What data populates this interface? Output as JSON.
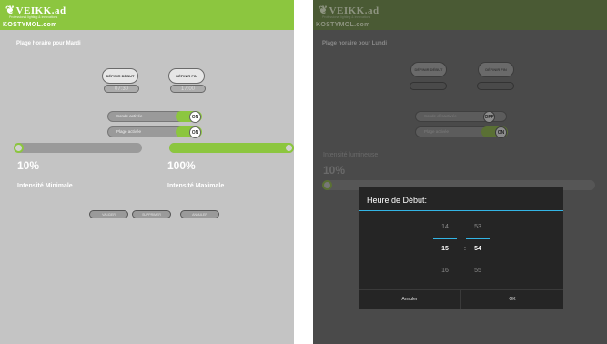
{
  "brand": {
    "logo_text": "VEIKK.ad",
    "tagline": "Professional lighting & innovations",
    "secondary": "KOSTYMOL.com"
  },
  "left": {
    "title": "Plage horaire pour Mardi",
    "set_start_label": "DÉFINIR DÉBUT",
    "set_end_label": "DÉFINIR FIN",
    "start_value": "07:30",
    "end_value": "17:00",
    "sensor_label": "Sonde activée",
    "sensor_state": "ON",
    "schedule_label": "Plage activée",
    "schedule_state": "ON",
    "min_pct": "10%",
    "max_pct": "100%",
    "min_label": "Intensité Minimale",
    "max_label": "Intensité Maximale",
    "min_fraction": 0.0,
    "max_fraction": 1.0,
    "buttons": {
      "validate": "VALIDER",
      "delete": "SUPPRIMER",
      "cancel": "ANNULER"
    }
  },
  "right": {
    "title": "Plage horaire pour Lundi",
    "set_start_label": "DÉFINIR DÉBUT",
    "set_end_label": "DÉFINIR FIN",
    "sensor_label": "Sonde désactivée",
    "sensor_state": "OFF",
    "schedule_label": "Plage activée",
    "schedule_state": "ON",
    "intensity_label": "Intensité lumineuse",
    "pct": "10%",
    "fraction": 0.0
  },
  "dialog": {
    "title": "Heure de Début:",
    "hours": [
      "14",
      "15",
      "16"
    ],
    "minutes": [
      "53",
      "54",
      "55"
    ],
    "separator": ":",
    "cancel_label": "Annuler",
    "ok_label": "OK"
  },
  "colors": {
    "accent": "#8cc63f",
    "dialog_accent": "#33b5e5",
    "dialog_bg": "#252525"
  }
}
